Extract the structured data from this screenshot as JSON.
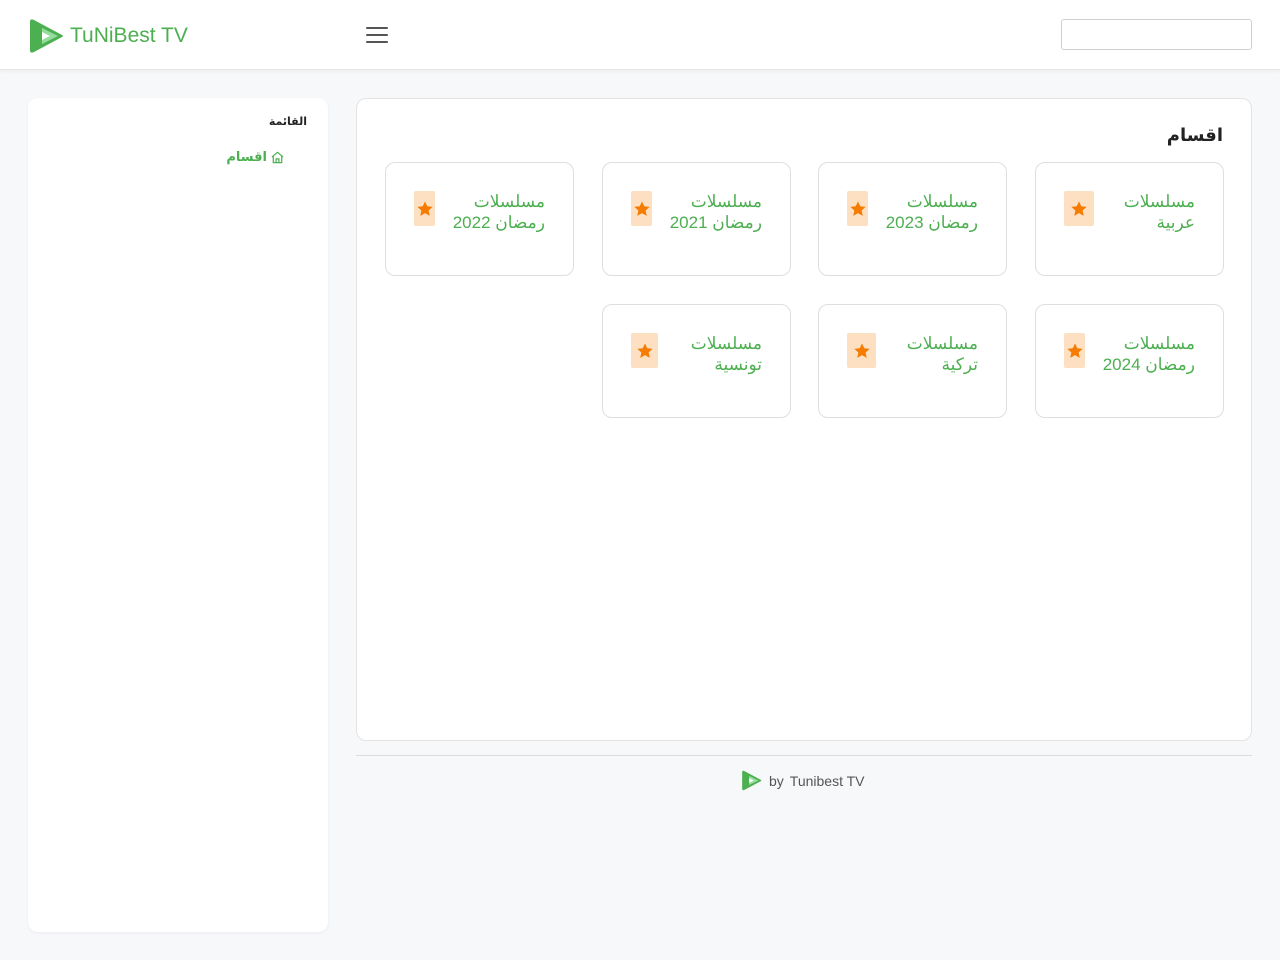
{
  "header": {
    "brand": "TuNiBest TV",
    "search": {
      "value": "",
      "placeholder": ""
    },
    "accent": "#4caf50"
  },
  "sidebar": {
    "title": "القائمة",
    "items": [
      {
        "label": "اقسام",
        "icon": "home-icon"
      }
    ]
  },
  "main": {
    "title": "اقسام",
    "categories": [
      {
        "label": "مسلسلات عربية",
        "icon": "star-icon"
      },
      {
        "label": "مسلسلات رمضان 2023",
        "icon": "star-icon"
      },
      {
        "label": "مسلسلات رمضان 2021",
        "icon": "star-icon"
      },
      {
        "label": "مسلسلات رمضان 2022",
        "icon": "star-icon"
      },
      {
        "label": "مسلسلات رمضان 2024",
        "icon": "star-icon"
      },
      {
        "label": "مسلسلات تركية",
        "icon": "star-icon"
      },
      {
        "label": "مسلسلات تونسية",
        "icon": "star-icon"
      }
    ],
    "icon_bg": "#fde0c2",
    "icon_color": "#f57c00"
  },
  "footer": {
    "by": "by",
    "name": "Tunibest TV"
  }
}
